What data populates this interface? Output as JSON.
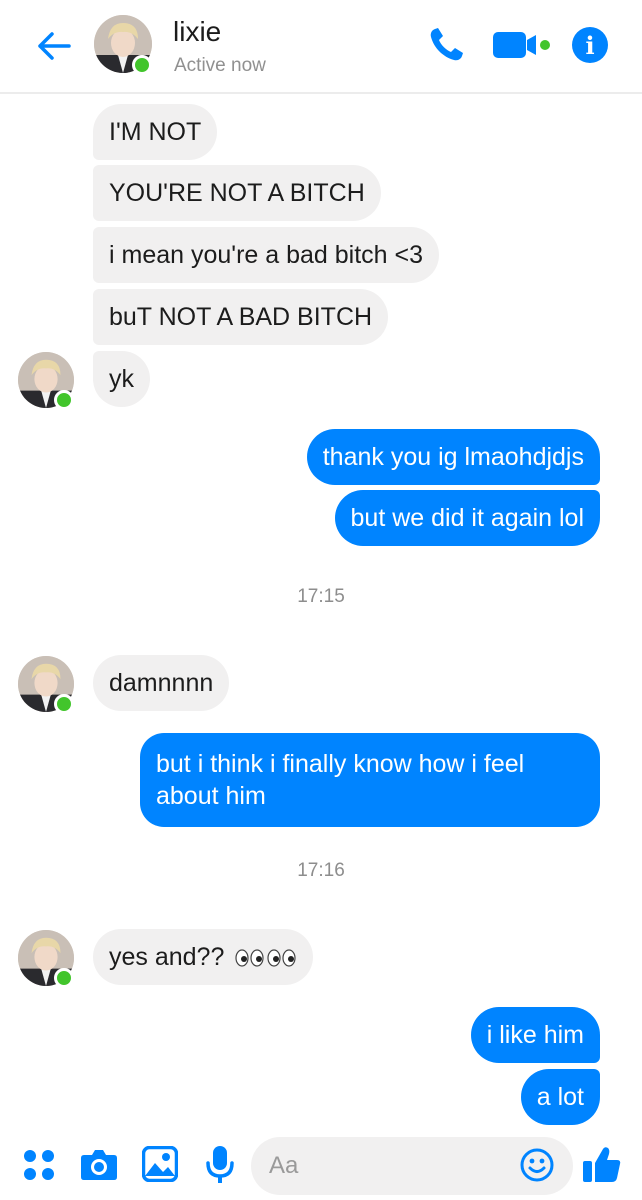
{
  "header": {
    "contact_name": "lixie",
    "status": "Active now"
  },
  "messages": [
    {
      "side": "in",
      "text": "I'M NOT"
    },
    {
      "side": "in",
      "text": "YOU'RE NOT A BITCH"
    },
    {
      "side": "in",
      "text": "i mean you're a bad bitch <3"
    },
    {
      "side": "in",
      "text": "buT NOT A BAD BITCH"
    },
    {
      "side": "in",
      "text": "yk"
    },
    {
      "side": "out",
      "text": "thank you ig lmaohdjdjs"
    },
    {
      "side": "out",
      "text": "but we did it again lol"
    },
    {
      "side": "in",
      "text": "damnnnn"
    },
    {
      "side": "out",
      "line1": "but i think i finally know how i feel",
      "line2": "about him"
    },
    {
      "side": "in",
      "text": "yes and??"
    },
    {
      "side": "out",
      "text": "i like him"
    },
    {
      "side": "out",
      "text": "a lot"
    }
  ],
  "timestamps": [
    "17:15",
    "17:16"
  ],
  "composer": {
    "placeholder": "Aa"
  },
  "icons": {
    "back": "arrow-left-icon",
    "call": "phone-icon",
    "video": "video-camera-icon",
    "info": "info-icon",
    "apps": "apps-grid-icon",
    "camera": "camera-icon",
    "gallery": "image-icon",
    "mic": "microphone-icon",
    "emoji": "smiley-icon",
    "like": "thumbs-up-icon",
    "eyes": "eyes-emoji-icon"
  },
  "colors": {
    "accent": "#0084ff",
    "incoming_bubble": "#f1f0f0",
    "online": "#42c52c"
  }
}
